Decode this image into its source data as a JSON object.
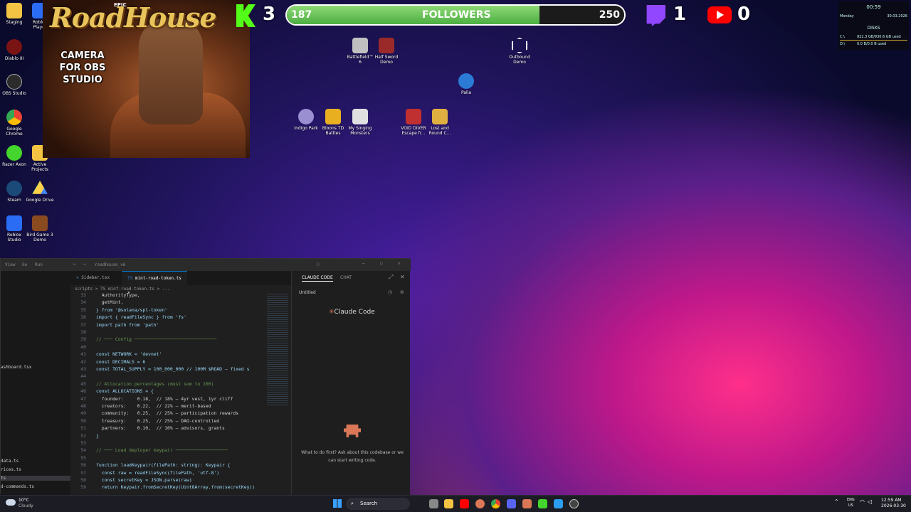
{
  "desktop_icons": [
    {
      "label": "Staging",
      "color": "#f3c443"
    },
    {
      "label": "Roblox Player",
      "color": "#2a6df4"
    },
    {
      "label": "Diablo III",
      "color": "#7a1414"
    },
    {
      "label": "OBS Studio",
      "color": "#2b2b2b"
    },
    {
      "label": "Google Chrome",
      "color": "#e94235"
    },
    {
      "label": "Razer Axon",
      "color": "#44d62c"
    },
    {
      "label": "Active Projects",
      "color": "#f3c443"
    },
    {
      "label": "Steam",
      "color": "#1b4a78"
    },
    {
      "label": "Google Drive",
      "color": "#1fa463"
    },
    {
      "label": "Roblox Studio",
      "color": "#2a6df4"
    },
    {
      "label": "Bird Game 3 Demo",
      "color": "#8a4a20"
    },
    {
      "label": "Battlefield™ 6",
      "color": "#c0c0c0"
    },
    {
      "label": "Half Sword Demo",
      "color": "#9a2a2a"
    },
    {
      "label": "Outbound Demo",
      "color": "#ffffff"
    },
    {
      "label": "Palia",
      "color": "#2a7ad6"
    },
    {
      "label": "Indigo Park",
      "color": "#9a8fd0"
    },
    {
      "label": "Bloons TD Battles",
      "color": "#e8b020"
    },
    {
      "label": "My Singing Monsters",
      "color": "#e0e0e0"
    },
    {
      "label": "VOID DIVER Escape fr...",
      "color": "#c03030"
    },
    {
      "label": "Lost and Round C...",
      "color": "#e0b040"
    }
  ],
  "camera": {
    "title": "RoadHouse",
    "epic": "EPIC",
    "label": "CAMERA FOR OBS STUDIO"
  },
  "stats": {
    "kick_count": "3",
    "followers_current": "187",
    "followers_label": "FOLLOWERS",
    "followers_goal": "250",
    "followers_progress": 0.748,
    "twitch_count": "1",
    "youtube_count": "0"
  },
  "sysmon": {
    "time": "00:59",
    "day": "Monday",
    "date": "30.03.2026",
    "disks_label": "DISKS",
    "disk1_label": "C:\\",
    "disk1_value": "922.3 GB/930.6 GB used",
    "disk2_label": "D:\\",
    "disk2_value": "0.0 B/0.0 B used"
  },
  "vscode": {
    "title": "roadhouse_v6",
    "menu": [
      "View",
      "Go",
      "Run"
    ],
    "tabs": [
      "Sidebar.tsx",
      "mint-road-token.ts"
    ],
    "breadcrumb": "scripts > TS mint-road-token.ts > ...",
    "sidebar_files": [
      "ashboard.tsx",
      "data.ts",
      "rices.ts",
      "ts",
      "d-commands.ts"
    ],
    "code_lines": [
      {
        "n": "33",
        "t": "  AuthorityType,"
      },
      {
        "n": "34",
        "t": "  getMint,"
      },
      {
        "n": "35",
        "t": "} from '@solana/spl-token'"
      },
      {
        "n": "36",
        "t": "import { readFileSync } from 'fs'"
      },
      {
        "n": "37",
        "t": "import path from 'path'"
      },
      {
        "n": "38",
        "t": ""
      },
      {
        "n": "39",
        "t": "// ─── Config ──────────────────────────────"
      },
      {
        "n": "40",
        "t": ""
      },
      {
        "n": "41",
        "t": "const NETWORK = 'devnet'"
      },
      {
        "n": "42",
        "t": "const DECIMALS = 6"
      },
      {
        "n": "43",
        "t": "const TOTAL_SUPPLY = 100_000_000 // 100M $ROAD — fixed s"
      },
      {
        "n": "44",
        "t": ""
      },
      {
        "n": "45",
        "t": "// Allocation percentages (must sum to 100)"
      },
      {
        "n": "46",
        "t": "const ALLOCATIONS = {"
      },
      {
        "n": "47",
        "t": "  founder:     0.18,  // 18% — 4yr vest, 1yr cliff"
      },
      {
        "n": "48",
        "t": "  creators:    0.22,  // 22% — merit-based"
      },
      {
        "n": "49",
        "t": "  community:   0.25,  // 25% — participation rewards"
      },
      {
        "n": "50",
        "t": "  treasury:    0.25,  // 25% — DAO-controlled"
      },
      {
        "n": "51",
        "t": "  partners:    0.10,  // 10% — advisors, grants"
      },
      {
        "n": "52",
        "t": "}"
      },
      {
        "n": "53",
        "t": ""
      },
      {
        "n": "54",
        "t": "// ─── Load deployer keypair ───────────────────"
      },
      {
        "n": "55",
        "t": ""
      },
      {
        "n": "56",
        "t": "function loadKeypair(filePath: string): Keypair {"
      },
      {
        "n": "57",
        "t": "  const raw = readFileSync(filePath, 'utf-8')"
      },
      {
        "n": "58",
        "t": "  const secretKey = JSON.parse(raw)"
      },
      {
        "n": "59",
        "t": "  return Keypair.fromSecretKey(Uint8Array.from(secretKey))"
      }
    ],
    "claude": {
      "tab1": "CLAUDE CODE",
      "tab2": "CHAT",
      "session": "Untitled",
      "logo": "Claude Code",
      "prompt": "What to do first? Ask about this codebase or we can start writing code."
    }
  },
  "taskbar": {
    "weather_temp": "10°C",
    "weather_desc": "Cloudy",
    "search": "Search",
    "lang1": "ENG",
    "lang2": "US",
    "time": "12:59 AM",
    "date": "2026-03-30"
  }
}
